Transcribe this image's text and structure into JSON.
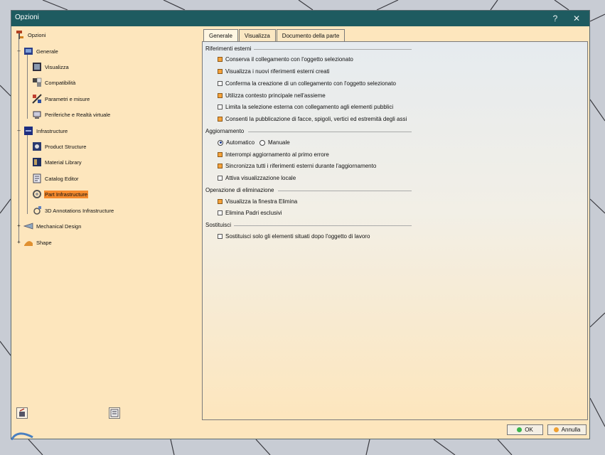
{
  "window": {
    "title": "Opzioni",
    "help": "?",
    "close": "✕"
  },
  "tree": {
    "root": "Opzioni",
    "items": [
      {
        "label": "Generale",
        "icon": "general-settings-icon"
      },
      {
        "label": "Visualizza",
        "icon": "display-icon"
      },
      {
        "label": "Compatibilità",
        "icon": "compatibility-icon"
      },
      {
        "label": "Parametri e misure",
        "icon": "parameters-icon"
      },
      {
        "label": "Periferiche e Realtà virtuale",
        "icon": "devices-icon"
      },
      {
        "label": "Infrastructure",
        "icon": "infrastructure-icon"
      },
      {
        "label": "Product Structure",
        "icon": "product-structure-icon"
      },
      {
        "label": "Material Library",
        "icon": "material-library-icon"
      },
      {
        "label": "Catalog Editor",
        "icon": "catalog-editor-icon"
      },
      {
        "label": "Part Infrastructure",
        "icon": "part-infrastructure-icon",
        "selected": true
      },
      {
        "label": "3D Annotations Infrastructure",
        "icon": "annotations-icon"
      },
      {
        "label": "Mechanical Design",
        "icon": "mechanical-design-icon"
      },
      {
        "label": "Shape",
        "icon": "shape-icon"
      }
    ]
  },
  "tabs": [
    "Generale",
    "Visualizza",
    "Documento della parte"
  ],
  "active_tab": "Generale",
  "sections": {
    "external_refs": {
      "title": "Riferimenti esterni",
      "options": [
        {
          "label": "Conserva il collegamento con l'oggetto selezionato",
          "checked": true
        },
        {
          "label": "Visualizza i nuovi riferimenti esterni creati",
          "checked": true
        },
        {
          "label": "Conferma la creazione di un collegamento con l'oggetto selezionato",
          "checked": false
        },
        {
          "label": "Utilizza contesto principale nell'assieme",
          "checked": true
        },
        {
          "label": "Limita la selezione esterna con collegamento agli elementi pubblici",
          "checked": false
        },
        {
          "label": "Consenti la pubblicazione di facce, spigoli, vertici ed estremità degli assi",
          "checked": true
        }
      ]
    },
    "update": {
      "title": "Aggiornamento",
      "radio_auto": "Automatico",
      "radio_manual": "Manuale",
      "selected": "Automatico",
      "options": [
        {
          "label": "Interrompi aggiornamento al primo errore",
          "checked": true
        },
        {
          "label": "Sincronizza tutti i riferimenti esterni durante l'aggiornamento",
          "checked": true
        },
        {
          "label": "Attiva visualizzazione locale",
          "checked": false
        }
      ]
    },
    "delete": {
      "title": "Operazione di eliminazione",
      "options": [
        {
          "label": "Visualizza la finestra Elimina",
          "checked": true
        },
        {
          "label": "Elimina Padri esclusivi",
          "checked": false
        }
      ]
    },
    "replace": {
      "title": "Sostituisci",
      "options": [
        {
          "label": "Sostituisci solo gli elementi situati dopo l'oggetto di lavoro",
          "checked": false
        }
      ]
    }
  },
  "footer": {
    "ok": "OK",
    "cancel": "Annulla"
  },
  "colors": {
    "title_bar": "#1e5b60",
    "dialog_bg": "#fde6bd",
    "selection": "#f58a2d",
    "checked": "#f5a23a",
    "ok_dot": "#3bb54a",
    "cancel_dot": "#f0a030"
  }
}
